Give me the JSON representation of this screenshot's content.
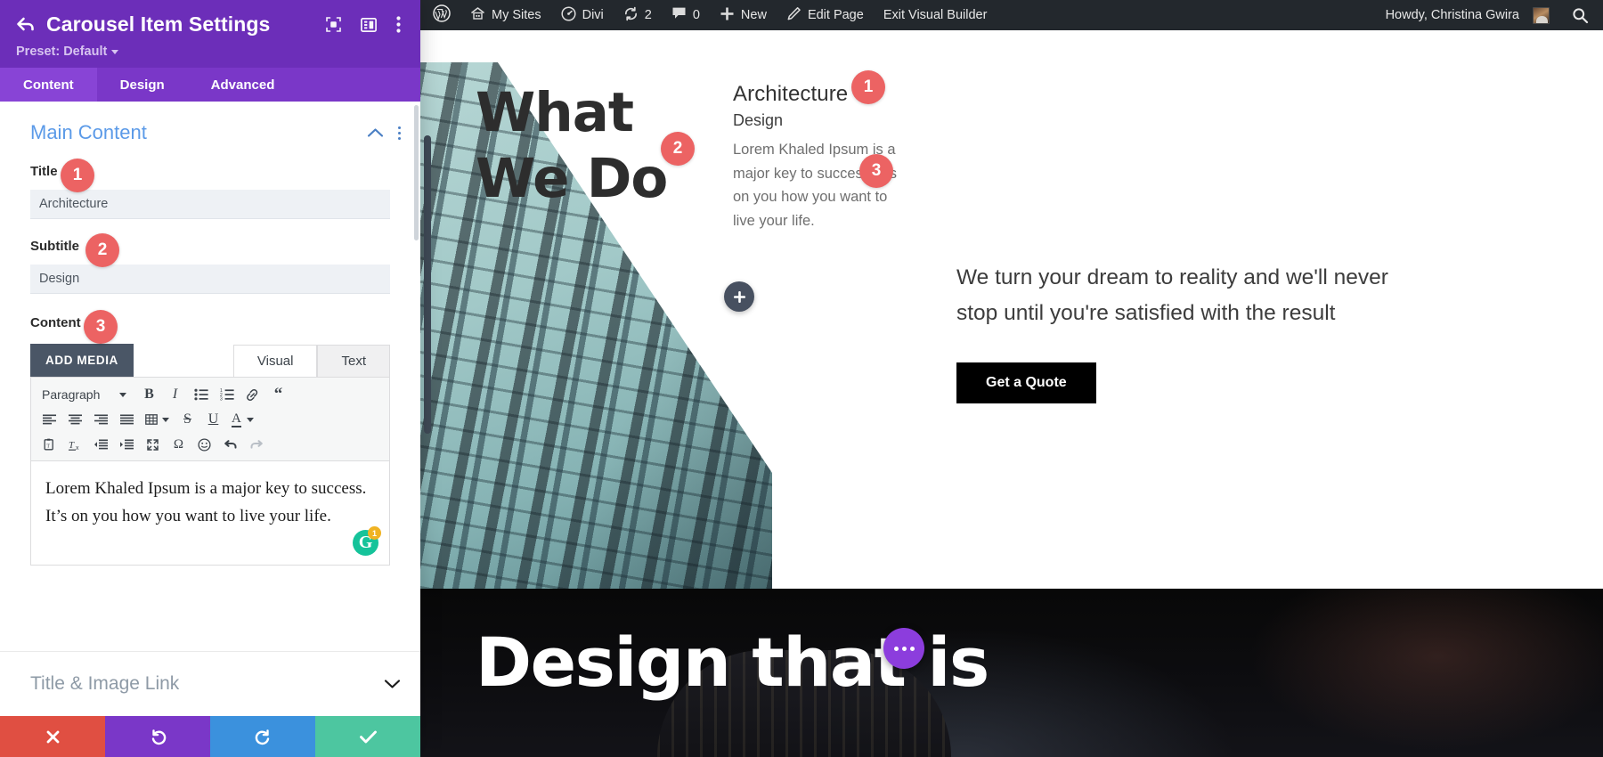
{
  "settings_panel": {
    "back_icon": "back-arrow-icon",
    "title": "Carousel Item Settings",
    "header_icons": [
      "focus-target-icon",
      "layout-panel-icon",
      "vertical-dots-icon"
    ],
    "preset_label": "Preset: Default",
    "tabs": [
      {
        "label": "Content",
        "active": true
      },
      {
        "label": "Design",
        "active": false
      },
      {
        "label": "Advanced",
        "active": false
      }
    ],
    "section": {
      "title": "Main Content",
      "collapse_icon": "chevron-up-icon",
      "menu_icon": "vertical-dots-icon"
    },
    "fields": {
      "title": {
        "label": "Title",
        "value": "Architecture",
        "marker": "1"
      },
      "subtitle": {
        "label": "Subtitle",
        "value": "Design",
        "marker": "2"
      },
      "content": {
        "label": "Content",
        "marker": "3"
      }
    },
    "editor": {
      "add_media_label": "ADD MEDIA",
      "tabs": [
        {
          "label": "Visual",
          "active": true
        },
        {
          "label": "Text",
          "active": false
        }
      ],
      "format_select": "Paragraph",
      "toolbar_row1": [
        "bold-icon",
        "italic-icon",
        "bulleted-list-icon",
        "numbered-list-icon",
        "link-icon",
        "blockquote-icon"
      ],
      "toolbar_row2": [
        "align-left-icon",
        "align-center-icon",
        "align-right-icon",
        "align-justify-icon",
        "table-icon",
        "strikethrough-icon",
        "underline-icon",
        "text-color-icon"
      ],
      "toolbar_row3": [
        "paste-as-text-icon",
        "clear-formatting-icon",
        "outdent-icon",
        "indent-icon",
        "fullscreen-icon",
        "special-character-icon",
        "emoji-icon",
        "undo-icon",
        "redo-icon"
      ],
      "body_text": "Lorem Khaled Ipsum is a major key to success. It’s on you how you want to live your life.",
      "grammarly": {
        "letter": "G",
        "count": "1"
      }
    },
    "collapsed_sections": [
      {
        "label": "Title & Image Link",
        "icon": "chevron-down-icon"
      }
    ],
    "actions": [
      {
        "name": "close",
        "icon": "✖",
        "color": "#e04f42"
      },
      {
        "name": "undo",
        "icon": "↺",
        "color": "#7a37c8"
      },
      {
        "name": "redo",
        "icon": "↻",
        "color": "#3b91dd"
      },
      {
        "name": "save",
        "icon": "✔",
        "color": "#4dc6a0"
      }
    ]
  },
  "admin_bar": {
    "items": [
      {
        "label": "",
        "icon": "wordpress-logo-icon"
      },
      {
        "label": "My Sites",
        "icon": "sites-icon"
      },
      {
        "label": "Divi",
        "icon": "divi-dashboard-icon"
      },
      {
        "label": "2",
        "icon": "updates-icon"
      },
      {
        "label": "0",
        "icon": "comments-icon"
      },
      {
        "label": "New",
        "icon": "plus-icon"
      },
      {
        "label": "Edit Page",
        "icon": "pencil-icon"
      },
      {
        "label": "Exit Visual Builder",
        "icon": ""
      }
    ],
    "howdy": "Howdy, Christina Gwira",
    "avatar_icon": "user-avatar",
    "search_icon": "search-icon"
  },
  "canvas": {
    "hero": {
      "heading_line1": "What",
      "heading_line2": "We Do",
      "marker_subtitle": "2",
      "carousel": {
        "title": "Architecture",
        "title_marker": "1",
        "subtitle": "Design",
        "body": "Lorem Khaled Ipsum is a major key to success. It’s on you how you want to live your life.",
        "body_marker": "3"
      },
      "add_module_icon": "plus-icon",
      "right_text": "We turn your dream to reality and we'll never stop until you're satisfied with the result",
      "cta_label": "Get a Quote"
    },
    "dark_section": {
      "heading": "Design that is",
      "fab_icon": "three-dots-icon"
    }
  },
  "colors": {
    "panel_purple": "#6c2eb9",
    "tab_purple": "#8844d6",
    "marker_red": "#ec6363",
    "section_blue": "#5b9ae8",
    "admin_dark": "#23282d",
    "fab_purple": "#8c3ddd"
  }
}
